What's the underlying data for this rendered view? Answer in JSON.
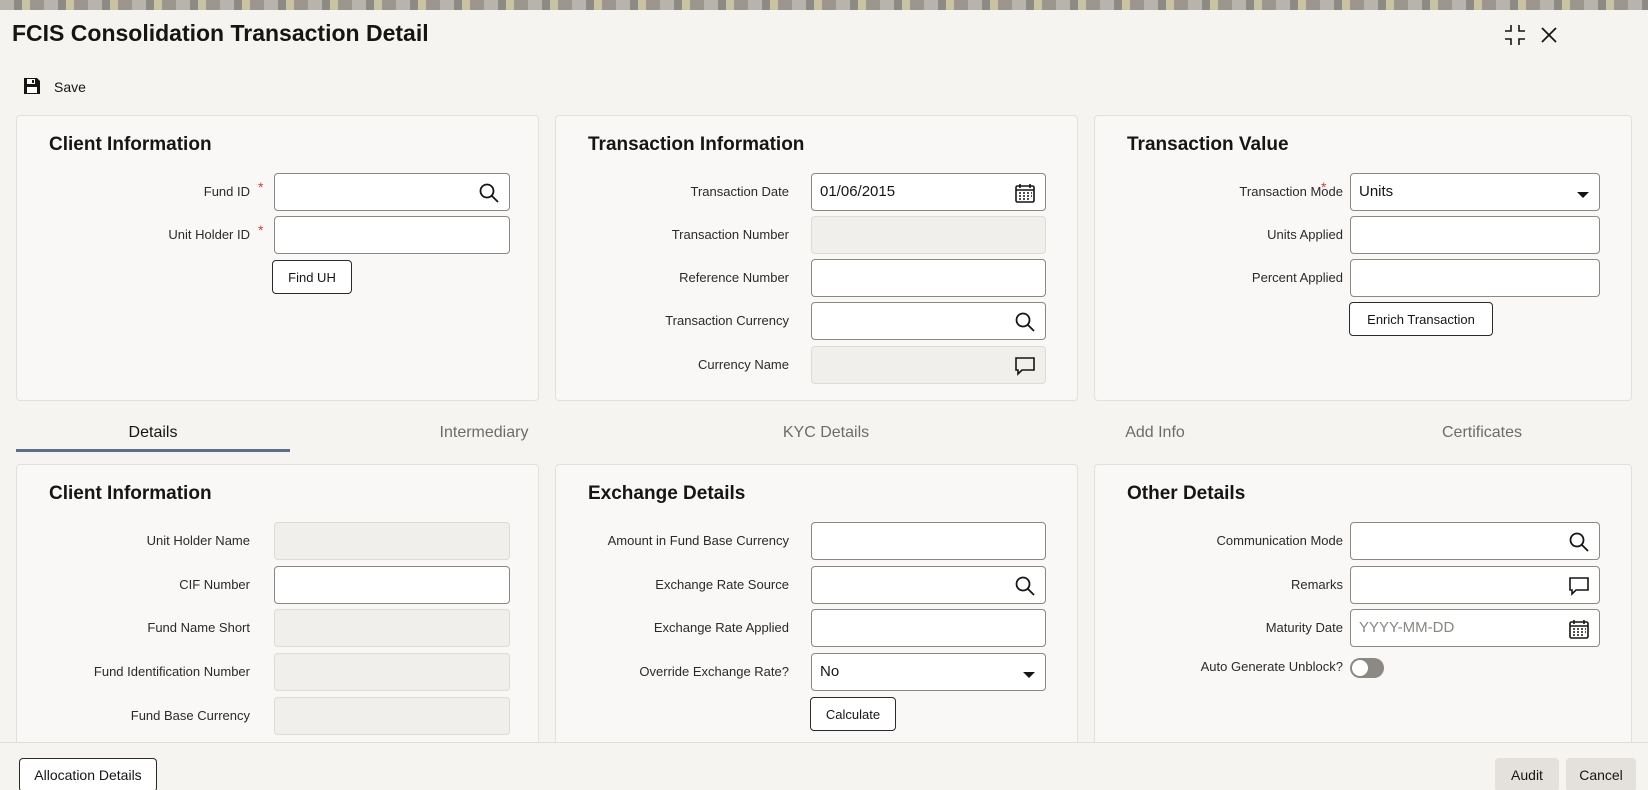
{
  "window": {
    "title": "FCIS Consolidation Transaction Detail"
  },
  "toolbar": {
    "save_label": "Save"
  },
  "client_info": {
    "title": "Client Information",
    "fund_id_label": "Fund ID",
    "fund_id_value": "",
    "unit_holder_id_label": "Unit Holder ID",
    "unit_holder_id_value": "",
    "find_uh_label": "Find UH",
    "required_mark": "*"
  },
  "transaction_info": {
    "title": "Transaction Information",
    "transaction_date_label": "Transaction Date",
    "transaction_date_value": "01/06/2015",
    "transaction_number_label": "Transaction Number",
    "reference_number_label": "Reference Number",
    "transaction_currency_label": "Transaction Currency",
    "currency_name_label": "Currency Name"
  },
  "transaction_value": {
    "title": "Transaction Value",
    "transaction_mode_label": "Transaction Mode",
    "transaction_mode_value": "Units",
    "units_applied_label": "Units Applied",
    "percent_applied_label": "Percent Applied",
    "enrich_label": "Enrich Transaction"
  },
  "tabs": [
    {
      "label": "Details",
      "active": true
    },
    {
      "label": "Intermediary",
      "active": false
    },
    {
      "label": "KYC Details",
      "active": false
    },
    {
      "label": "Add Info",
      "active": false
    },
    {
      "label": "Certificates",
      "active": false
    }
  ],
  "details_client": {
    "title": "Client Information",
    "unit_holder_name_label": "Unit Holder Name",
    "cif_number_label": "CIF Number",
    "fund_name_short_label": "Fund Name Short",
    "fund_identification_number_label": "Fund Identification Number",
    "fund_base_currency_label": "Fund Base Currency"
  },
  "exchange": {
    "title": "Exchange Details",
    "amount_label": "Amount in Fund Base Currency",
    "rate_source_label": "Exchange Rate Source",
    "rate_applied_label": "Exchange Rate Applied",
    "override_label": "Override Exchange Rate?",
    "override_value": "No",
    "calculate_label": "Calculate"
  },
  "other": {
    "title": "Other Details",
    "communication_mode_label": "Communication Mode",
    "remarks_label": "Remarks",
    "maturity_date_label": "Maturity Date",
    "maturity_date_placeholder": "YYYY-MM-DD",
    "auto_unblock_label": "Auto Generate Unblock?"
  },
  "footer": {
    "allocation_label": "Allocation Details",
    "audit_label": "Audit",
    "cancel_label": "Cancel"
  },
  "icons": {
    "search": "search-icon",
    "calendar": "calendar-icon",
    "comment": "comment-icon",
    "dropdown": "caret-down-icon",
    "save": "floppy-disk-icon",
    "collapse": "collapse-icon",
    "close": "close-icon"
  },
  "colors": {
    "required": "#c74634",
    "tab_active_underline": "#5c6e8a"
  }
}
